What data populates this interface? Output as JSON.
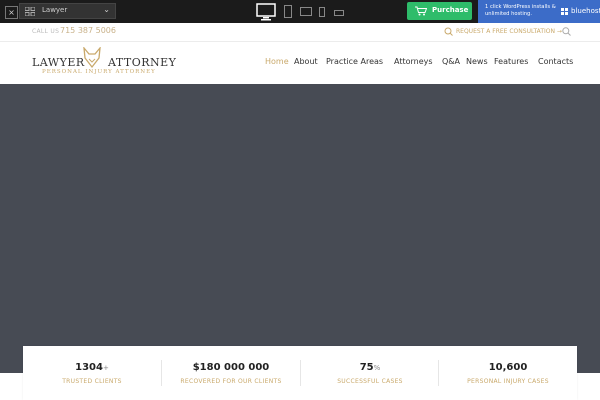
{
  "topbar": {
    "close_label": "×",
    "theme_name": "Lawyer",
    "purchase_label": "Purchase",
    "bluehost_text": "1 click WordPress installs & unlimited hosting.",
    "bluehost_brand": "bluehost"
  },
  "infobar": {
    "call_label": "CALL US",
    "phone": "715 387 5006",
    "consult_label": "REQUEST A FREE CONSULTATION →"
  },
  "logo": {
    "left": "LAWYER",
    "right": "ATTORNEY",
    "sub": "PERSONAL INJURY ATTORNEY"
  },
  "nav": [
    "Home",
    "About",
    "Practice Areas",
    "Attorneys",
    "Q&A",
    "News",
    "Features",
    "Contacts"
  ],
  "nav_active": "Home",
  "stats": [
    {
      "value": "1304",
      "suffix": "+",
      "caption": "TRUSTED CLIENTS"
    },
    {
      "value": "$180 000 000",
      "suffix": "",
      "caption": "RECOVERED FOR OUR CLIENTS"
    },
    {
      "value": "75",
      "suffix": "%",
      "caption": "SUCCESSFUL CASES"
    },
    {
      "value": "10,600",
      "suffix": "",
      "caption": "PERSONAL INJURY CASES"
    }
  ],
  "colors": {
    "accent": "#c9a96b",
    "hero": "#474b54",
    "purchase": "#2ebc6a",
    "bluehost": "#3c6cc8"
  }
}
